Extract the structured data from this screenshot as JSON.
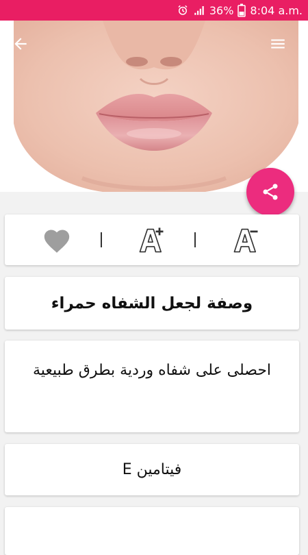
{
  "status_bar": {
    "battery": "36%",
    "time": "8:04 a.m."
  },
  "header": {
    "back_icon": "arrow-back-icon",
    "menu_icon": "hamburger-menu-icon",
    "image": "lips-photo"
  },
  "fab": {
    "icon": "share-icon",
    "color": "#ec2c7e"
  },
  "actions": {
    "favorite_icon": "heart-icon",
    "increase_font_icon": "font-increase-icon",
    "decrease_font_icon": "font-decrease-icon"
  },
  "article": {
    "title": "وصفة لجعل الشفاه حمراء",
    "subtitle": "احصلى على شفاه وردية بطرق طبيعية",
    "section": "فيتامين E"
  },
  "colors": {
    "status_bar": "#e91e63",
    "accent": "#ec2c7e",
    "background": "#f2f2f2"
  }
}
